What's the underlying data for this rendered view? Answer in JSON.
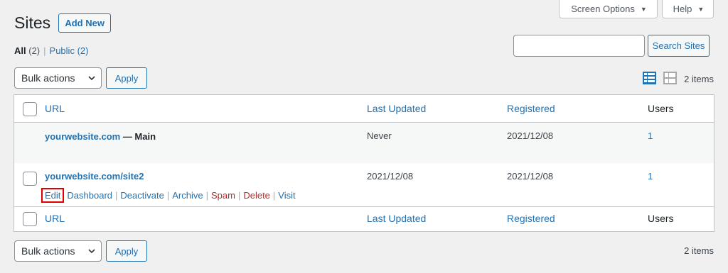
{
  "screen_meta": {
    "screen_options": "Screen Options",
    "help": "Help"
  },
  "header": {
    "title": "Sites",
    "add_new": "Add New"
  },
  "filters": {
    "all_label": "All",
    "all_count": "(2)",
    "sep": "|",
    "public_label": "Public",
    "public_count": "(2)"
  },
  "search": {
    "value": "",
    "button": "Search Sites"
  },
  "bulk": {
    "selected": "Bulk actions",
    "apply": "Apply"
  },
  "items_count": "2 items",
  "table": {
    "columns": {
      "url": "URL",
      "last_updated": "Last Updated",
      "registered": "Registered",
      "users": "Users"
    },
    "rows": [
      {
        "url": "yourwebsite.com",
        "suffix": " — Main",
        "last_updated": "Never",
        "registered": "2021/12/08",
        "users": "1"
      },
      {
        "url": "yourwebsite.com/site2",
        "last_updated": "2021/12/08",
        "registered": "2021/12/08",
        "users": "1",
        "actions": {
          "edit": "Edit",
          "dashboard": "Dashboard",
          "deactivate": "Deactivate",
          "archive": "Archive",
          "spam": "Spam",
          "delete": "Delete",
          "visit": "Visit",
          "sep": "|"
        }
      }
    ]
  },
  "colors": {
    "link": "#2271b1",
    "danger": "#b32d2e",
    "highlight": "#e00000",
    "background": "#f0f0f1"
  }
}
